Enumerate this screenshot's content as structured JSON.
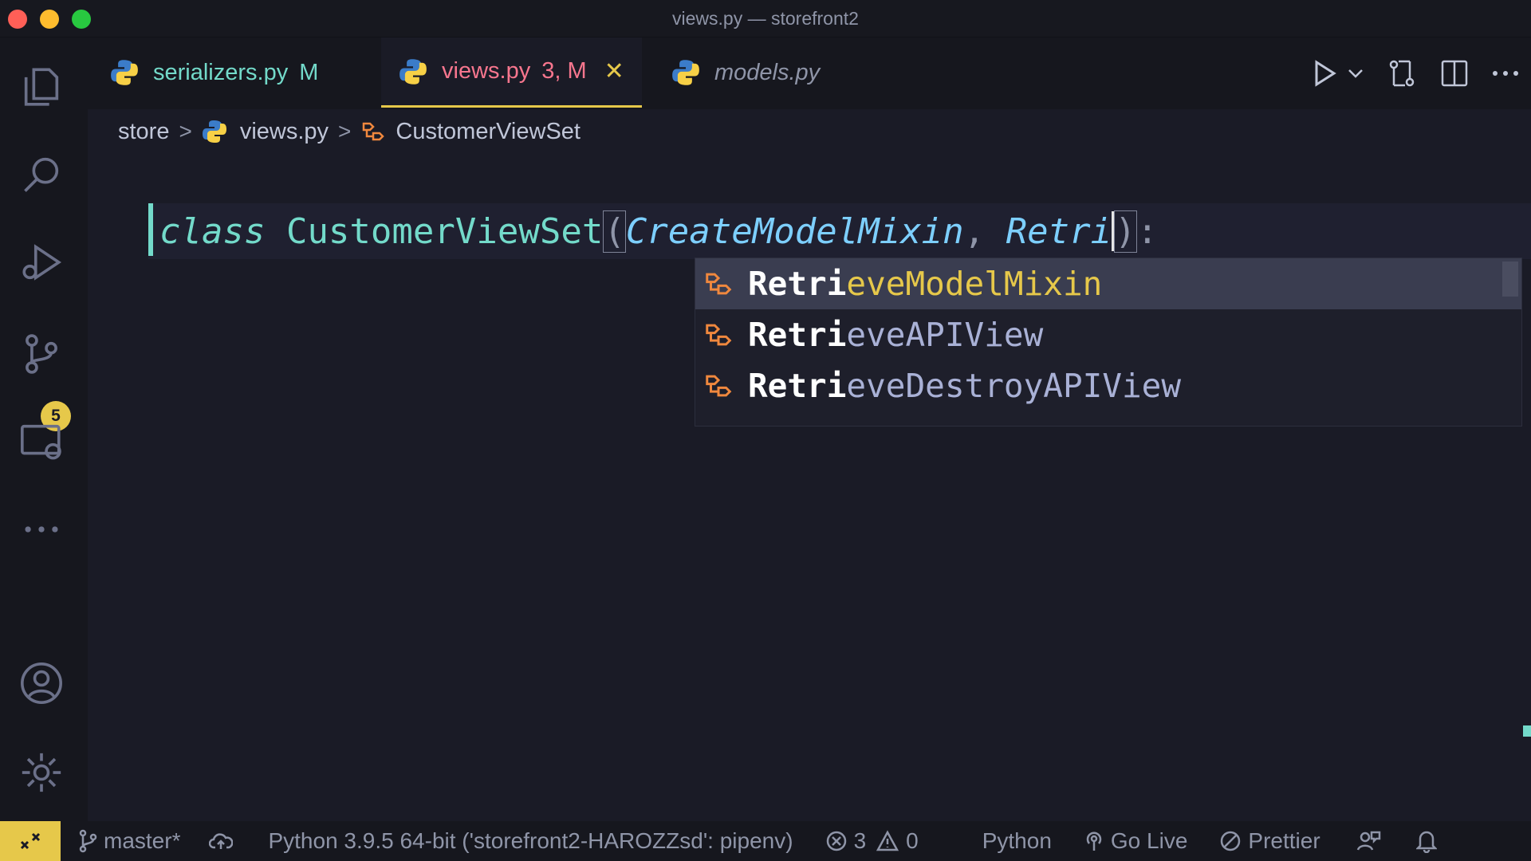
{
  "window": {
    "title": "views.py — storefront2"
  },
  "tabs": [
    {
      "label": "serializers.py",
      "status": "M",
      "color": "#73daca"
    },
    {
      "label": "views.py",
      "status": "3, M",
      "color": "#f7768e",
      "active": true
    },
    {
      "label": "models.py",
      "status": "",
      "color": "#8f95a8",
      "italic": true
    }
  ],
  "breadcrumb": {
    "folder": "store",
    "file": "views.py",
    "symbol": "CustomerViewSet"
  },
  "editor": {
    "keyword": "class",
    "class_name": "CustomerViewSet",
    "open_paren": "(",
    "base1": "CreateModelMixin",
    "comma": ", ",
    "typed": "Retri",
    "close_paren": ")",
    "colon": ":"
  },
  "suggestions": [
    {
      "match": "Retri",
      "rest": "eveModelMixin",
      "icon": "class-icon",
      "selected": true
    },
    {
      "match": "Retri",
      "rest": "eveAPIView",
      "icon": "class-icon"
    },
    {
      "match": "Retri",
      "rest": "eveDestroyAPIView",
      "icon": "class-icon"
    }
  ],
  "activity_bar": {
    "source_control_badge": "5"
  },
  "statusbar": {
    "branch": "master*",
    "interpreter": "Python 3.9.5 64-bit ('storefront2-HAROZZsd': pipenv)",
    "errors": "3",
    "warnings": "0",
    "language": "Python",
    "go_live": "Go Live",
    "prettier": "Prettier"
  },
  "colors": {
    "accent": "#e6c84a",
    "teal": "#73daca",
    "pink": "#f7768e"
  }
}
